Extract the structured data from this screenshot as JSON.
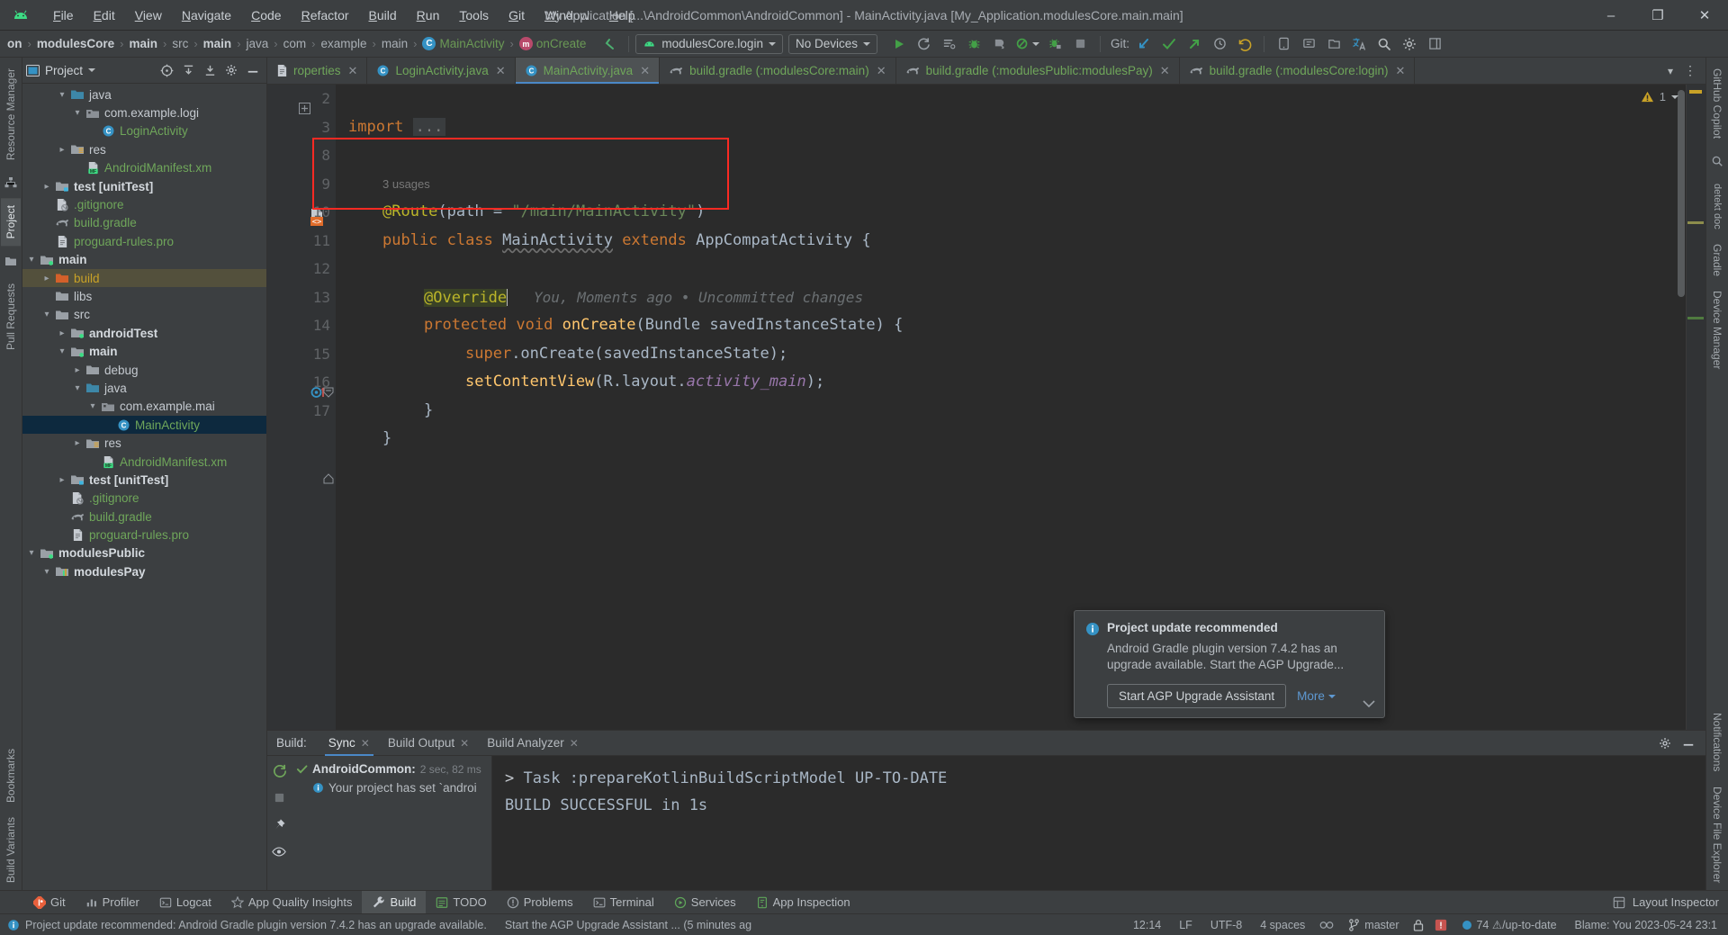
{
  "window": {
    "title": "My Application [...\\AndroidCommon\\AndroidCommon] - MainActivity.java [My_Application.modulesCore.main.main]",
    "minimize": "–",
    "maximize": "❐",
    "close": "✕"
  },
  "menu": [
    "File",
    "Edit",
    "View",
    "Navigate",
    "Code",
    "Refactor",
    "Build",
    "Run",
    "Tools",
    "Git",
    "Window",
    "Help"
  ],
  "breadcrumb": [
    {
      "label": "on",
      "bold": true,
      "icon": ""
    },
    {
      "label": "modulesCore",
      "bold": true,
      "icon": ""
    },
    {
      "label": "main",
      "bold": true,
      "icon": ""
    },
    {
      "label": "src",
      "bold": false,
      "icon": ""
    },
    {
      "label": "main",
      "bold": true,
      "icon": ""
    },
    {
      "label": "java",
      "bold": false,
      "icon": ""
    },
    {
      "label": "com",
      "bold": false,
      "icon": ""
    },
    {
      "label": "example",
      "bold": false,
      "icon": ""
    },
    {
      "label": "main",
      "bold": false,
      "icon": ""
    },
    {
      "label": "MainActivity",
      "bold": false,
      "icon": "class"
    },
    {
      "label": "onCreate",
      "bold": false,
      "icon": "method"
    }
  ],
  "toolbar": {
    "run_config": "modulesCore.login",
    "device": "No Devices",
    "git_label": "Git:",
    "run_button": "run-icon",
    "rerun_button": "rerun-icon",
    "applychanges_button": "apply-changes-icon",
    "debug_button": "debug-icon",
    "profile_button": "profile-icon",
    "coverage_button": "coverage-icon",
    "attach_debugger_button": "attach-debugger-icon",
    "stop_button": "stop-icon",
    "update_project": "update-project-icon",
    "commit": "commit-icon",
    "push": "push-icon",
    "history": "history-icon",
    "undo": "undo-icon",
    "search_everywhere": "search-icon",
    "settings": "gear-icon"
  },
  "project_panel": {
    "title": "Project",
    "tree": [
      {
        "depth": 4,
        "arrow": "down",
        "icon": "folder-java",
        "label": "java",
        "style": "white"
      },
      {
        "depth": 5,
        "arrow": "down",
        "icon": "package",
        "label": "com.example.logi",
        "style": "white"
      },
      {
        "depth": 6,
        "arrow": "none",
        "icon": "class",
        "label": "LoginActivity",
        "style": "green"
      },
      {
        "depth": 4,
        "arrow": "right",
        "icon": "folder-res",
        "label": "res",
        "style": "white"
      },
      {
        "depth": 5,
        "arrow": "none",
        "icon": "manifest",
        "label": "AndroidManifest.xm",
        "style": "green"
      },
      {
        "depth": 3,
        "arrow": "right",
        "icon": "folder-test",
        "label": "test [unitTest]",
        "style": "bold"
      },
      {
        "depth": 3,
        "arrow": "none",
        "icon": "gitignore",
        "label": ".gitignore",
        "style": "green"
      },
      {
        "depth": 3,
        "arrow": "none",
        "icon": "gradle",
        "label": "build.gradle",
        "style": "green"
      },
      {
        "depth": 3,
        "arrow": "none",
        "icon": "file",
        "label": "proguard-rules.pro",
        "style": "green"
      },
      {
        "depth": 2,
        "arrow": "down",
        "icon": "folder-module",
        "label": "main",
        "style": "bold"
      },
      {
        "depth": 3,
        "arrow": "right",
        "icon": "folder-build",
        "label": "build",
        "style": "orange",
        "row": "build-sel"
      },
      {
        "depth": 3,
        "arrow": "none",
        "icon": "folder-plain",
        "label": "libs",
        "style": "white"
      },
      {
        "depth": 3,
        "arrow": "down",
        "icon": "folder-plain",
        "label": "src",
        "style": "white"
      },
      {
        "depth": 4,
        "arrow": "right",
        "icon": "folder-module",
        "label": "androidTest",
        "style": "bold"
      },
      {
        "depth": 4,
        "arrow": "down",
        "icon": "folder-module",
        "label": "main",
        "style": "bold"
      },
      {
        "depth": 5,
        "arrow": "right",
        "icon": "folder-plain",
        "label": "debug",
        "style": "white"
      },
      {
        "depth": 5,
        "arrow": "down",
        "icon": "folder-java",
        "label": "java",
        "style": "white"
      },
      {
        "depth": 6,
        "arrow": "down",
        "icon": "package",
        "label": "com.example.mai",
        "style": "white"
      },
      {
        "depth": 7,
        "arrow": "none",
        "icon": "class",
        "label": "MainActivity",
        "style": "green",
        "row": "sel"
      },
      {
        "depth": 5,
        "arrow": "right",
        "icon": "folder-res",
        "label": "res",
        "style": "white"
      },
      {
        "depth": 6,
        "arrow": "none",
        "icon": "manifest",
        "label": "AndroidManifest.xm",
        "style": "green"
      },
      {
        "depth": 4,
        "arrow": "right",
        "icon": "folder-test",
        "label": "test [unitTest]",
        "style": "bold"
      },
      {
        "depth": 4,
        "arrow": "none",
        "icon": "gitignore",
        "label": ".gitignore",
        "style": "green"
      },
      {
        "depth": 4,
        "arrow": "none",
        "icon": "gradle",
        "label": "build.gradle",
        "style": "green"
      },
      {
        "depth": 4,
        "arrow": "none",
        "icon": "file",
        "label": "proguard-rules.pro",
        "style": "green"
      },
      {
        "depth": 2,
        "arrow": "down",
        "icon": "folder-module",
        "label": "modulesPublic",
        "style": "bold"
      },
      {
        "depth": 3,
        "arrow": "down",
        "icon": "folder-android",
        "label": "modulesPay",
        "style": "bold"
      }
    ]
  },
  "left_stripe": [
    "Resource Manager",
    "Project",
    "Pull Requests",
    "Bookmarks",
    "Build Variants",
    "Structure"
  ],
  "right_stripe": [
    "Notifications",
    "Gradle",
    "Device Manager",
    "Device File Explorer",
    "GitHub Copilot"
  ],
  "editor_tabs": [
    {
      "label": "roperties",
      "icon": "file",
      "active": false
    },
    {
      "label": "LoginActivity.java",
      "icon": "class",
      "active": false
    },
    {
      "label": "MainActivity.java",
      "icon": "class",
      "active": true
    },
    {
      "label": "build.gradle (:modulesCore:main)",
      "icon": "gradle",
      "active": false
    },
    {
      "label": "build.gradle (:modulesPublic:modulesPay)",
      "icon": "gradle",
      "active": false
    },
    {
      "label": "build.gradle (:modulesCore:login)",
      "icon": "gradle",
      "active": false
    }
  ],
  "editor": {
    "warning_count": "1",
    "line_numbers": [
      "2",
      "3",
      "8",
      "9",
      "10",
      "11",
      "12",
      "13",
      "14",
      "15",
      "16",
      "17"
    ],
    "usage_hint": "3 usages",
    "blame_text": "You, Moments ago • Uncommitted changes",
    "code": {
      "import_kw": "import",
      "import_dots": "...",
      "route_annotation": "@Route",
      "route_path_key": "path",
      "route_path_value": "\"/main/MainActivity\"",
      "class_decl_public": "public",
      "class_decl_class": "class",
      "class_name": "MainActivity",
      "class_decl_extends": "extends",
      "class_super": "AppCompatActivity",
      "override": "@Override",
      "method_protected": "protected",
      "method_void": "void",
      "method_name": "onCreate",
      "method_param_type": "Bundle",
      "method_param_name": "savedInstanceState",
      "super_kw": "super",
      "super_call": "onCreate(savedInstanceState);",
      "setcontent_call": "setContentView",
      "setcontent_r": "R",
      "setcontent_layout": "layout",
      "setcontent_field": "activity_main"
    }
  },
  "build_panel": {
    "title": "Build:",
    "tabs": [
      {
        "label": "Sync",
        "active": true
      },
      {
        "label": "Build Output",
        "active": false
      },
      {
        "label": "Build Analyzer",
        "active": false
      }
    ],
    "tree": [
      {
        "label": "AndroidCommon:",
        "time": "2 sec, 82 ms",
        "icon": "check",
        "color": "#d4d9de"
      },
      {
        "label": "Your project has set `androi",
        "time": "",
        "icon": "info",
        "color": "#b6bbc0"
      }
    ],
    "output_lines": [
      "> Task :prepareKotlinBuildScriptModel UP-TO-DATE",
      "",
      "BUILD SUCCESSFUL in 1s"
    ]
  },
  "notification": {
    "title": "Project update recommended",
    "body": "Android Gradle plugin version 7.4.2 has an upgrade available. Start the AGP Upgrade...",
    "primary_action": "Start AGP Upgrade Assistant",
    "secondary_action": "More"
  },
  "bottom_tabs": [
    {
      "label": "Git",
      "icon": "git-icon",
      "active": false
    },
    {
      "label": "Profiler",
      "icon": "profiler-icon",
      "active": false
    },
    {
      "label": "Logcat",
      "icon": "logcat-icon",
      "active": false
    },
    {
      "label": "App Quality Insights",
      "icon": "insights-icon",
      "active": false
    },
    {
      "label": "Build",
      "icon": "build-icon",
      "active": true
    },
    {
      "label": "TODO",
      "icon": "todo-icon",
      "active": false
    },
    {
      "label": "Problems",
      "icon": "problems-icon",
      "active": false
    },
    {
      "label": "Terminal",
      "icon": "terminal-icon",
      "active": false
    },
    {
      "label": "Services",
      "icon": "services-icon",
      "active": false
    },
    {
      "label": "App Inspection",
      "icon": "inspection-icon",
      "active": false
    }
  ],
  "bottom_right": {
    "layout_inspector": "Layout Inspector"
  },
  "statusbar": {
    "message": "Project update recommended: Android Gradle plugin version 7.4.2 has an upgrade available.",
    "action": "Start the AGP Upgrade Assistant ... (5 minutes ag",
    "caret": "12:14",
    "line_sep": "LF",
    "encoding": "UTF-8",
    "indent": "4 spaces",
    "branch": "master",
    "updates": "74 ⚠/up-to-date",
    "blame": "Blame: You 2023-05-24 23:1"
  },
  "colors": {
    "accent_blue": "#4a88c7",
    "green_text": "#6fa65a",
    "panel_bg": "#3c3f41",
    "editor_bg": "#2b2b2b",
    "highlight_red": "#fa2a23",
    "selection_blue": "#0d293e"
  }
}
